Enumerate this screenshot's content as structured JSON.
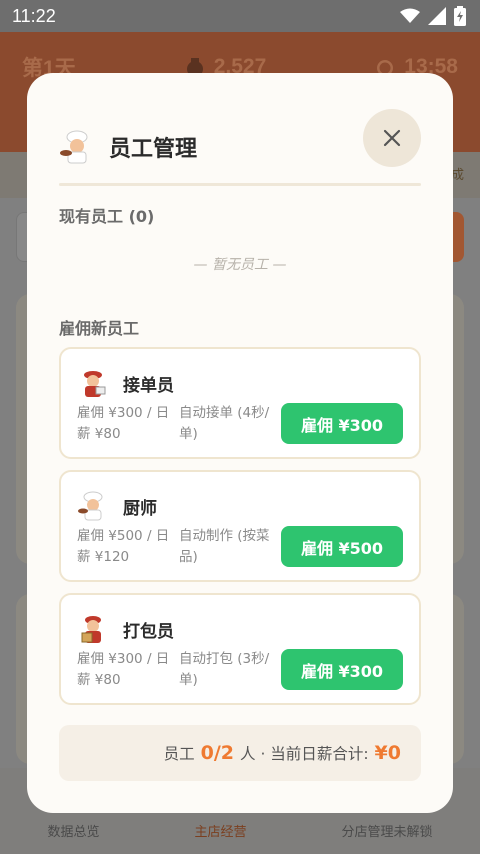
{
  "status_bar": {
    "time": "11:22",
    "wifi_icon": "wifi-icon",
    "signal_icon": "signal-icon",
    "battery_icon": "battery-icon"
  },
  "app_header": {
    "day": "第1天",
    "money": "2,527",
    "time": "13:58"
  },
  "bottom_nav": {
    "items": [
      "数据总览",
      "主店经营",
      "分店管理未解锁"
    ]
  },
  "modal": {
    "title": "员工管理",
    "title_icon": "chef-icon",
    "close_icon": "close-icon",
    "current_staff_label": "现有员工 (0)",
    "empty_text": "— 暂无员工 —",
    "hire_section_label": "雇佣新员工",
    "staff": [
      {
        "name": "接单员",
        "icon": "order-taker-icon",
        "cost": "雇佣 ¥300 / 日薪 ¥80",
        "effect": "自动接单 (4秒/单)",
        "hire_label": "雇佣 ¥300"
      },
      {
        "name": "厨师",
        "icon": "chef-icon",
        "cost": "雇佣 ¥500 / 日薪 ¥120",
        "effect": "自动制作 (按菜品)",
        "hire_label": "雇佣 ¥500"
      },
      {
        "name": "打包员",
        "icon": "packer-icon",
        "cost": "雇佣 ¥300 / 日薪 ¥80",
        "effect": "自动打包 (3秒/单)",
        "hire_label": "雇佣 ¥300"
      }
    ],
    "summary": {
      "prefix": "员工",
      "count": "0/2",
      "middle": "人 · 当前日薪合计:",
      "total": "¥0"
    }
  },
  "colors": {
    "accent_green": "#2ec46f",
    "accent_orange": "#ef7a31",
    "header_brown": "#8b4a2e"
  }
}
